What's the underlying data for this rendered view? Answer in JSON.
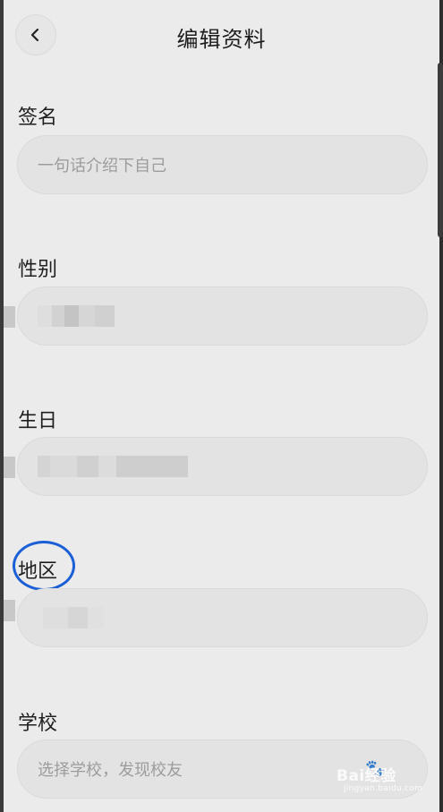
{
  "header": {
    "title": "编辑资料",
    "back_icon": "chevron-left-icon"
  },
  "sections": {
    "signature": {
      "label": "签名",
      "placeholder": "一句话介绍下自己"
    },
    "gender": {
      "label": "性别"
    },
    "birthday": {
      "label": "生日"
    },
    "region": {
      "label": "地区"
    },
    "school": {
      "label": "学校",
      "placeholder": "选择学校，发现校友"
    }
  },
  "watermark": {
    "brand": "Bai经验",
    "sub": "jingyan.baidu.com"
  },
  "colors": {
    "highlight": "#1a5fd6",
    "background": "#ebebeb",
    "field": "#e3e3e3"
  }
}
